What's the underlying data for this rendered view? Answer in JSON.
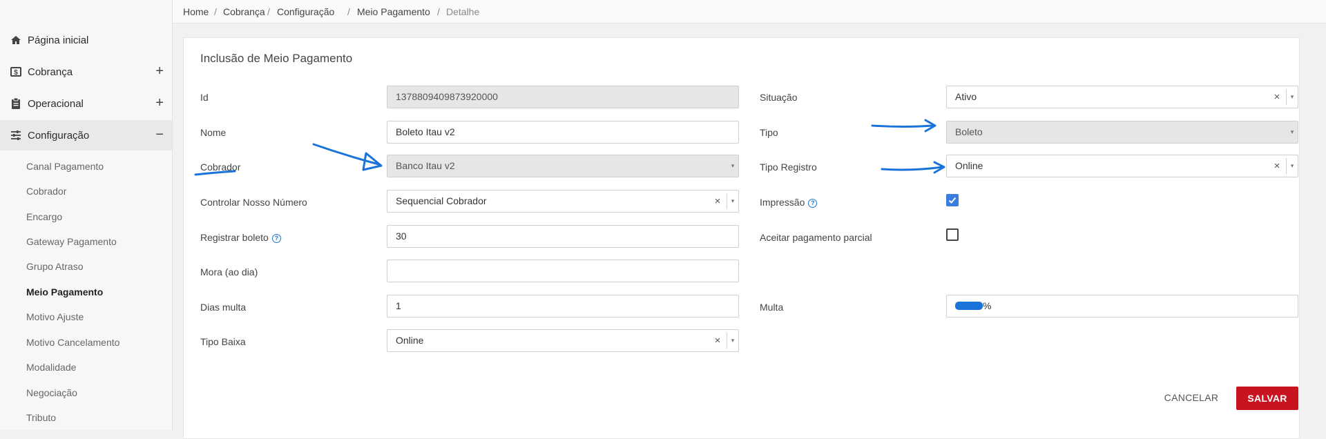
{
  "sidebar": {
    "main": [
      {
        "label": "Página inicial",
        "icon": "home-icon",
        "toggle": ""
      },
      {
        "label": "Cobrança",
        "icon": "dollar-box-icon",
        "toggle": "+"
      },
      {
        "label": "Operacional",
        "icon": "clipboard-icon",
        "toggle": "+"
      },
      {
        "label": "Configuração",
        "icon": "sliders-icon",
        "toggle": "−"
      }
    ],
    "sub": [
      "Canal Pagamento",
      "Cobrador",
      "Encargo",
      "Gateway Pagamento",
      "Grupo Atraso",
      "Meio Pagamento",
      "Motivo Ajuste",
      "Motivo Cancelamento",
      "Modalidade",
      "Negociação",
      "Tributo"
    ],
    "active_sub": "Meio Pagamento"
  },
  "breadcrumb": [
    "Home",
    "Cobrança",
    "Configuração",
    "Meio Pagamento",
    "Detalhe"
  ],
  "form": {
    "title": "Inclusão de Meio Pagamento",
    "id": {
      "label": "Id",
      "value": "1378809409873920000"
    },
    "nome": {
      "label": "Nome",
      "value": "Boleto Itau v2"
    },
    "cobrador": {
      "label": "Cobrador",
      "value": "Banco Itau v2"
    },
    "controlar": {
      "label": "Controlar Nosso Número",
      "value": "Sequencial Cobrador"
    },
    "registrar": {
      "label": "Registrar boleto",
      "value": "30"
    },
    "mora": {
      "label": "Mora (ao dia)",
      "value": ""
    },
    "dias_multa": {
      "label": "Dias multa",
      "value": "1"
    },
    "tipo_baixa": {
      "label": "Tipo Baixa",
      "value": "Online"
    },
    "situacao": {
      "label": "Situação",
      "value": "Ativo"
    },
    "tipo": {
      "label": "Tipo",
      "value": "Boleto"
    },
    "tipo_registro": {
      "label": "Tipo Registro",
      "value": "Online"
    },
    "impressao": {
      "label": "Impressão",
      "checked": true
    },
    "aceitar": {
      "label": "Aceitar pagamento parcial",
      "checked": false
    },
    "multa": {
      "label": "Multa",
      "suffix": "%"
    }
  },
  "glyphs": {
    "clear": "×",
    "caret": "▾",
    "help": "?"
  },
  "buttons": {
    "cancel": "CANCELAR",
    "save": "SALVAR"
  },
  "colors": {
    "accent": "#c8141f",
    "checkbox": "#3a7de0",
    "annotation": "#1a73d9"
  }
}
